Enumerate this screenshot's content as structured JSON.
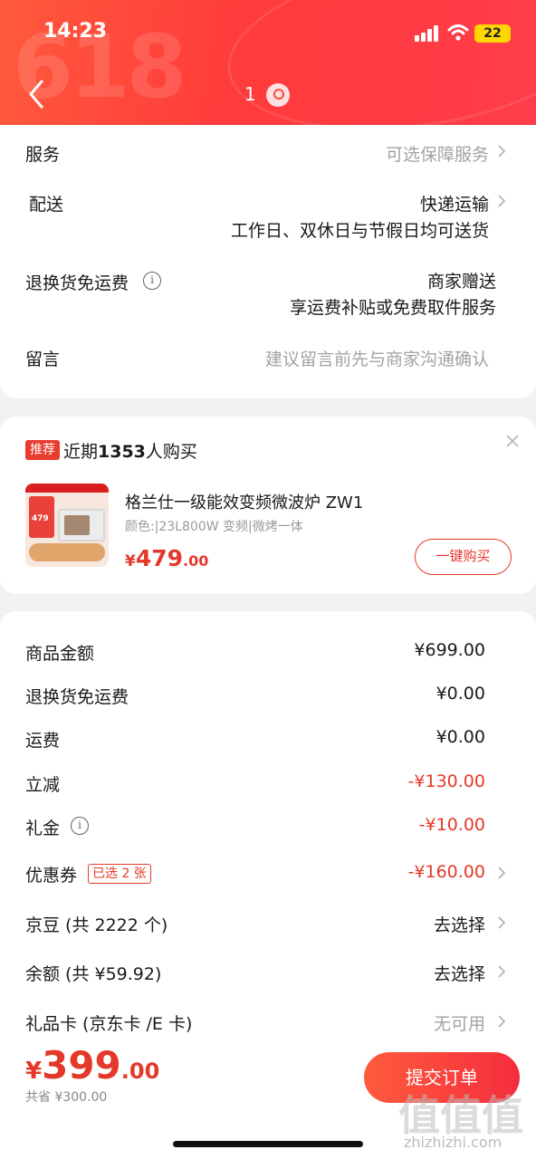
{
  "status_bar": {
    "time": "14:23",
    "battery": "22"
  },
  "header": {
    "bg_text": "618",
    "page_indicator": "1"
  },
  "service_section": {
    "service": {
      "label": "服务",
      "value": "可选保障服务"
    },
    "delivery": {
      "label": "配送",
      "value": "快递运输",
      "sub": "工作日、双休日与节假日均可送货"
    },
    "return_shipping": {
      "label": "退换货免运费",
      "value": "商家赠送",
      "sub": "享运费补贴或免费取件服务"
    },
    "message": {
      "label": "留言",
      "placeholder": "建议留言前先与商家沟通确认"
    }
  },
  "recommend": {
    "tag": "推荐",
    "title_prefix": "近期",
    "title_count": "1353",
    "title_suffix": "人购买",
    "product": {
      "name": "格兰仕一级能效变频微波炉 ZW1",
      "spec": "颜色:|23L800W 变频|微烤一体",
      "price_symbol": "¥",
      "price_int": "479",
      "price_dec": ".00",
      "buy_label": "一键购买",
      "thumb_price": "479"
    }
  },
  "summary": {
    "goods_amount": {
      "label": "商品金额",
      "value": "¥699.00"
    },
    "return_fee": {
      "label": "退换货免运费",
      "value": "¥0.00"
    },
    "shipping": {
      "label": "运费",
      "value": "¥0.00"
    },
    "instant_discount": {
      "label": "立减",
      "value": "-¥130.00"
    },
    "gift_money": {
      "label": "礼金",
      "value": "-¥10.00"
    },
    "coupon": {
      "label": "优惠券",
      "badge": "已选 2 张",
      "value": "-¥160.00"
    },
    "jd_beans": {
      "label": "京豆 (共 2222 个)",
      "value": "去选择"
    },
    "balance": {
      "label": "余额 (共 ¥59.92)",
      "value": "去选择"
    },
    "gift_card": {
      "label": "礼品卡 (京东卡 /E 卡)",
      "value": "无可用"
    }
  },
  "bottom_bar": {
    "price_symbol": "¥",
    "price_int": "399",
    "price_dec": ".00",
    "saved": "共省 ¥300.00",
    "submit_label": "提交订单"
  },
  "watermark": {
    "glyphs": "值",
    "site": "zhizhizhi.com"
  },
  "colors": {
    "accent": "#e4392a",
    "header_red": "#ff3b3b",
    "muted": "#a3a3a3"
  }
}
